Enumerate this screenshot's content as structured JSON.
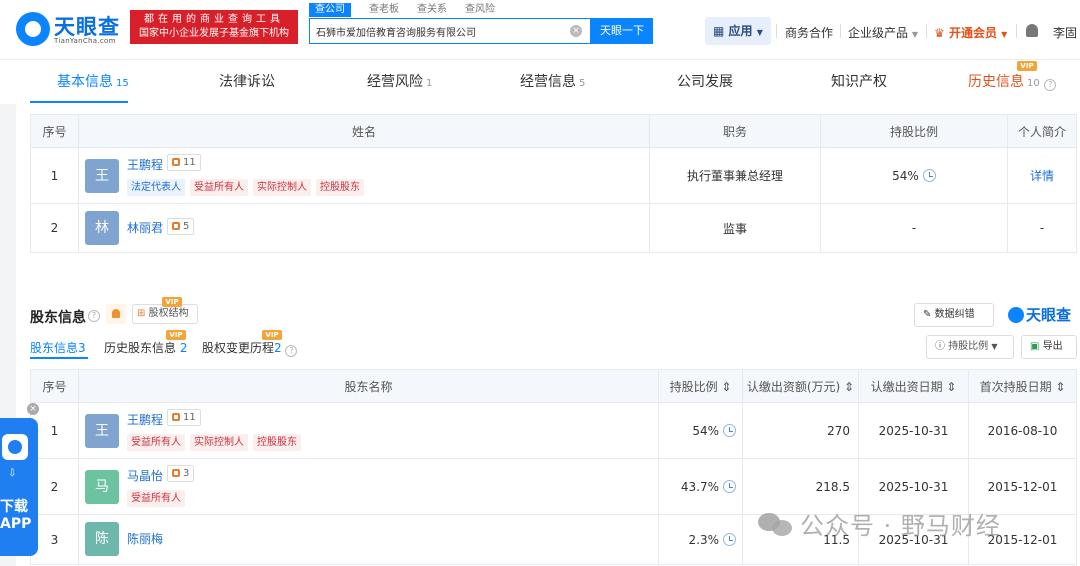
{
  "header": {
    "logo_text": "天眼查",
    "logo_sub": "TianYanCha.com",
    "slogan_line1": "都在用的商业查询工具",
    "slogan_line2": "国家中小企业发展子基金旗下机构",
    "search_tabs": [
      "查公司",
      "查老板",
      "查关系",
      "查风险"
    ],
    "search_value": "石狮市爱加倍教育咨询服务有限公司",
    "search_button": "天眼一下",
    "app_button": "应用",
    "links": [
      "商务合作",
      "企业级产品",
      "开通会员"
    ],
    "user": "李固"
  },
  "section_tabs": [
    {
      "label": "基本信息",
      "count": "15"
    },
    {
      "label": "法律诉讼",
      "count": ""
    },
    {
      "label": "经营风险",
      "count": "1"
    },
    {
      "label": "经营信息",
      "count": "5"
    },
    {
      "label": "公司发展",
      "count": ""
    },
    {
      "label": "知识产权",
      "count": ""
    },
    {
      "label": "历史信息",
      "count": "10"
    }
  ],
  "vip_badge": "VIP",
  "staff_table": {
    "headers": [
      "序号",
      "姓名",
      "职务",
      "持股比例",
      "个人简介"
    ],
    "rows": [
      {
        "index": "1",
        "avatar": "王",
        "name": "王鹏程",
        "relations": "11",
        "tags_blue": [
          "法定代表人"
        ],
        "tags_red": [
          "受益所有人",
          "实际控制人",
          "控股股东"
        ],
        "position": "执行董事兼总经理",
        "ratio": "54%",
        "intro": "详情"
      },
      {
        "index": "2",
        "avatar": "林",
        "name": "林丽君",
        "relations": "5",
        "position": "监事",
        "ratio": "-",
        "intro": "-"
      }
    ]
  },
  "shareholders": {
    "title": "股东信息",
    "equity_button": "股权结构",
    "correct_button": "数据纠错",
    "mini_logo": "天眼查",
    "tabs": [
      {
        "label": "股东信息",
        "count": "3"
      },
      {
        "label": "历史股东信息",
        "count": "2"
      },
      {
        "label": "股权变更历程",
        "count": "2"
      }
    ],
    "sort_button": "持股比例",
    "export_button": "导出",
    "headers": [
      "序号",
      "股东名称",
      "持股比例 ⇕",
      "认缴出资额(万元) ⇕",
      "认缴出资日期 ⇕",
      "首次持股日期 ⇕"
    ],
    "rows": [
      {
        "index": "1",
        "avatar": "王",
        "name": "王鹏程",
        "relations": "11",
        "tags": [
          "受益所有人",
          "实际控制人",
          "控股股东"
        ],
        "ratio": "54%",
        "amount": "270",
        "date": "2025-10-31",
        "first": "2016-08-10"
      },
      {
        "index": "2",
        "avatar": "马",
        "name": "马晶怡",
        "relations": "3",
        "tags": [
          "受益所有人"
        ],
        "ratio": "43.7%",
        "amount": "218.5",
        "date": "2025-10-31",
        "first": "2015-12-01"
      },
      {
        "index": "3",
        "avatar": "陈",
        "name": "陈丽梅",
        "relations": "",
        "tags": [],
        "ratio": "2.3%",
        "amount": "11.5",
        "date": "2025-10-31",
        "first": "2015-12-01"
      }
    ]
  },
  "float_app": {
    "line1": "下载",
    "line2": "APP"
  },
  "watermark": "公众号 · 野马财经",
  "colors": {
    "brand": "#0a84ff",
    "red": "#d8202a",
    "vip": "#e2531c"
  }
}
